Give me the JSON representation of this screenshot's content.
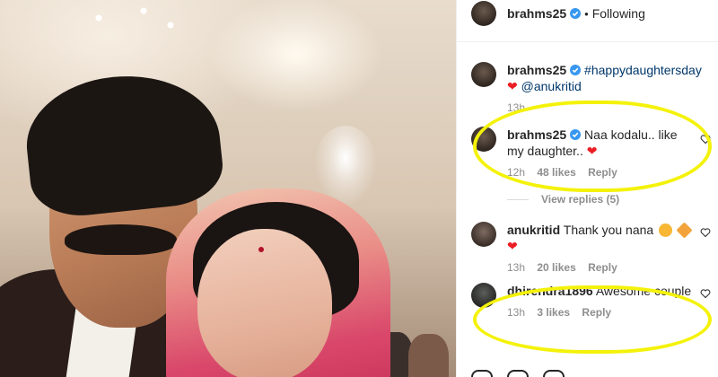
{
  "post": {
    "username": "brahms25",
    "separator": "•",
    "follow_status": "Following"
  },
  "caption": {
    "username": "brahms25",
    "hashtag": "#happydaughtersday",
    "mention": "@anukritid",
    "time": "13h"
  },
  "comments": [
    {
      "username": "brahms25",
      "text": "Naa kodalu.. like my daughter..",
      "time": "12h",
      "likes": "48 likes",
      "reply": "Reply"
    },
    {
      "view_replies": "View replies (5)"
    },
    {
      "username": "anukritid",
      "text": "Thank you nana",
      "time": "13h",
      "likes": "20 likes",
      "reply": "Reply"
    },
    {
      "username": "dhirendra1896",
      "text": "Awesome couple",
      "time": "13h",
      "likes": "3 likes",
      "reply": "Reply"
    }
  ],
  "colors": {
    "highlight": "#f4f20a",
    "link": "#00376b",
    "verified": "#3897f0",
    "heart": "#ed1c24"
  },
  "icons": [
    "verified-badge-icon",
    "heart-icon",
    "like-outline-icon",
    "emoji-face-icon",
    "emoji-flower-icon"
  ]
}
